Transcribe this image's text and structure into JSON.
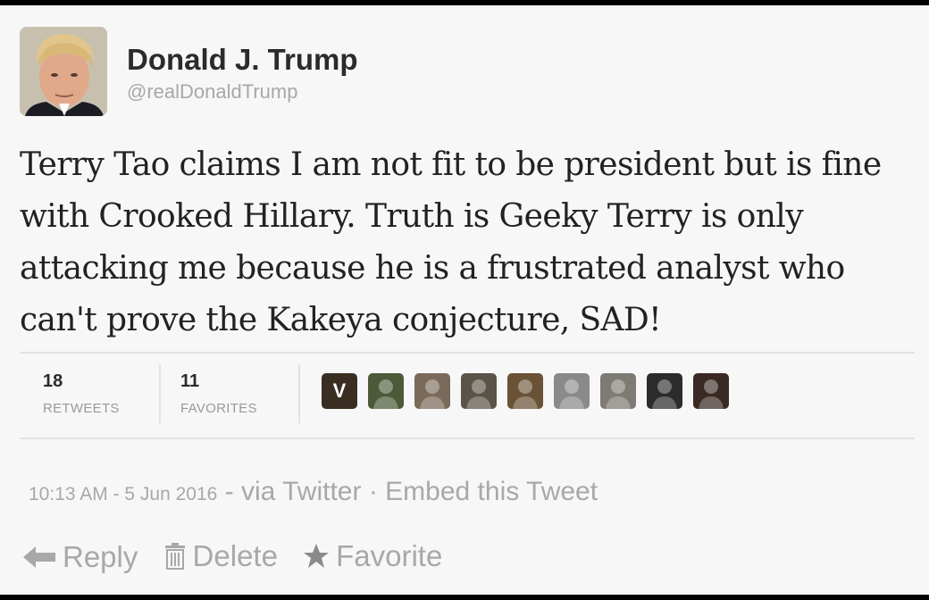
{
  "author": {
    "name": "Donald J. Trump",
    "handle": "@realDonaldTrump"
  },
  "tweet": {
    "text": "Terry Tao claims I am not fit to be president but is fine with Crooked Hillary. Truth is Geeky Terry is only attacking me because he is a frustrated analyst who can't prove the Kakeya conjecture, SAD!"
  },
  "stats": {
    "retweets": {
      "count": "18",
      "label": "RETWEETS"
    },
    "favorites": {
      "count": "11",
      "label": "FAVORITES"
    }
  },
  "favoriters": [
    {
      "name": "favoriter-v",
      "letter": "V",
      "color": "#3a2e22"
    },
    {
      "name": "favoriter-2",
      "letter": "",
      "color": "#4c5a3a"
    },
    {
      "name": "favoriter-3",
      "letter": "",
      "color": "#7a6a5a"
    },
    {
      "name": "favoriter-4",
      "letter": "",
      "color": "#5a5448"
    },
    {
      "name": "favoriter-5",
      "letter": "",
      "color": "#6a5236"
    },
    {
      "name": "favoriter-6",
      "letter": "",
      "color": "#8a8a8a"
    },
    {
      "name": "favoriter-7",
      "letter": "",
      "color": "#7e7a74"
    },
    {
      "name": "favoriter-8",
      "letter": "",
      "color": "#2c2c2c"
    },
    {
      "name": "favoriter-9",
      "letter": "",
      "color": "#3a2a24"
    }
  ],
  "meta": {
    "timestamp": "10:13 AM - 5 Jun 2016",
    "separator": " - ",
    "source": "via Twitter",
    "dot": " · ",
    "embed": "Embed this Tweet"
  },
  "actions": {
    "reply": "Reply",
    "delete": "Delete",
    "favorite": "Favorite"
  },
  "colors": {
    "background": "#f7f7f7",
    "muted_text": "#a8a8a8",
    "body_text": "#222222"
  }
}
